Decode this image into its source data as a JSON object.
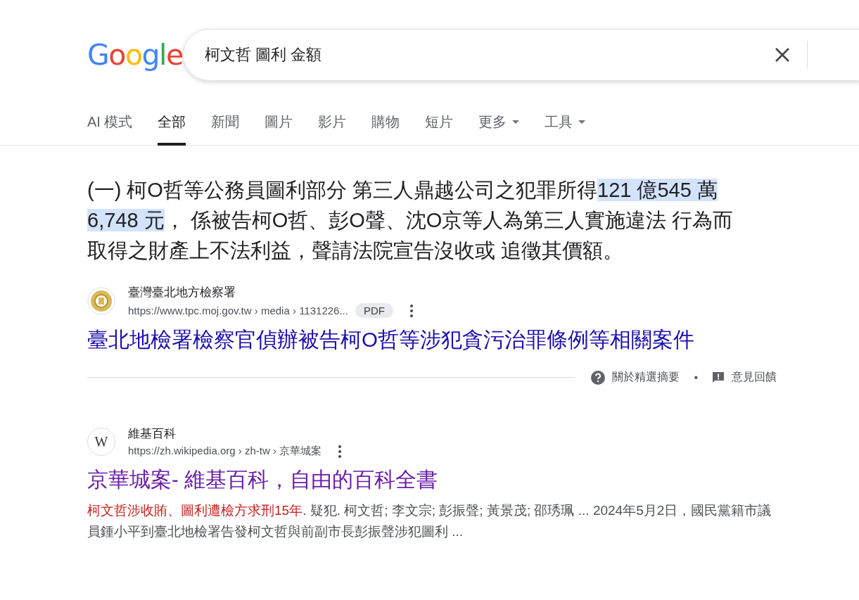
{
  "logo": "Google",
  "search": {
    "value": "柯文哲 圖利 金額"
  },
  "tabs": [
    {
      "label": "AI 模式",
      "selected": false,
      "kind": "plain"
    },
    {
      "label": "全部",
      "selected": true,
      "kind": "plain"
    },
    {
      "label": "新聞",
      "selected": false,
      "kind": "plain"
    },
    {
      "label": "圖片",
      "selected": false,
      "kind": "plain"
    },
    {
      "label": "影片",
      "selected": false,
      "kind": "plain"
    },
    {
      "label": "購物",
      "selected": false,
      "kind": "plain"
    },
    {
      "label": "短片",
      "selected": false,
      "kind": "plain"
    },
    {
      "label": "更多",
      "selected": false,
      "kind": "dropdown"
    },
    {
      "label": "工具",
      "selected": false,
      "kind": "dropdown"
    }
  ],
  "featured_snippet": {
    "text_before": "(一) 柯O哲等公務員圖利部分 第三人鼎越公司之犯罪所得",
    "highlight": "121 億545 萬 6,748 元",
    "text_after": "， 係被告柯O哲、彭O聲、沈O京等人為第三人實施違法 行為而取得之財產上不法利益，聲請法院宣告沒收或 追徵其價額。",
    "source": {
      "site": "臺灣臺北地方檢察署",
      "url": "https://www.tpc.moj.gov.tw › media › 1131226...",
      "badge": "PDF",
      "title": "臺北地檢署檢察官偵辦被告柯O哲等涉犯貪污治罪條例等相關案件",
      "visited": false
    },
    "footer": {
      "about": "關於精選摘要",
      "separator": "•",
      "feedback": "意見回饋"
    }
  },
  "results": [
    {
      "site": "維基百科",
      "favicon_letter": "W",
      "url": "https://zh.wikipedia.org › zh-tw › 京華城案",
      "title": "京華城案- 維基百科，自由的百科全書",
      "visited": true,
      "emphasis": "柯文哲涉收賄、圖利遭檢方求刑15年",
      "snippet": ". 疑犯. 柯文哲; 李文宗; 彭振聲; 黃景茂; 邵琇珮 ... 2024年5月2日，國民黨籍市議員鍾小平到臺北地檢署告發柯文哲與前副市長彭振聲涉犯圖利 ..."
    }
  ]
}
